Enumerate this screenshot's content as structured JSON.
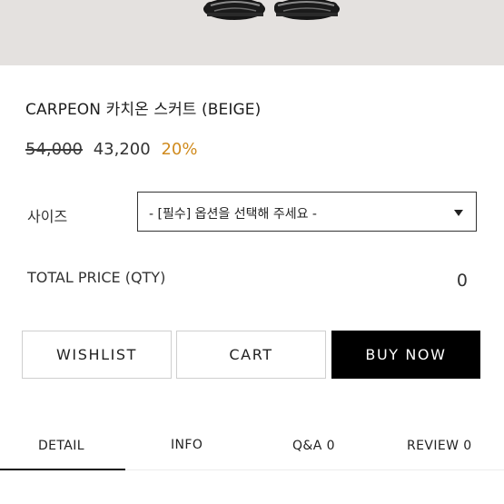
{
  "product": {
    "title": "CARPEON 카치온 스커트 (BEIGE)",
    "original_price": "54,000",
    "sale_price": "43,200",
    "discount": "20%"
  },
  "options": {
    "size_label": "사이즈",
    "size_selected": "- [필수] 옵션을 선택해 주세요 -"
  },
  "total": {
    "label": "TOTAL PRICE (QTY)",
    "value": "0"
  },
  "buttons": {
    "wishlist": "WISHLIST",
    "cart": "CART",
    "buy_now": "BUY NOW"
  },
  "tabs": {
    "detail": "DETAIL",
    "info": "INFO",
    "qa": "Q&A 0",
    "review": "REVIEW 0"
  },
  "colors": {
    "discount": "#d08b1e",
    "buy_button_bg": "#000000",
    "photo_bg": "#e4e1df"
  }
}
